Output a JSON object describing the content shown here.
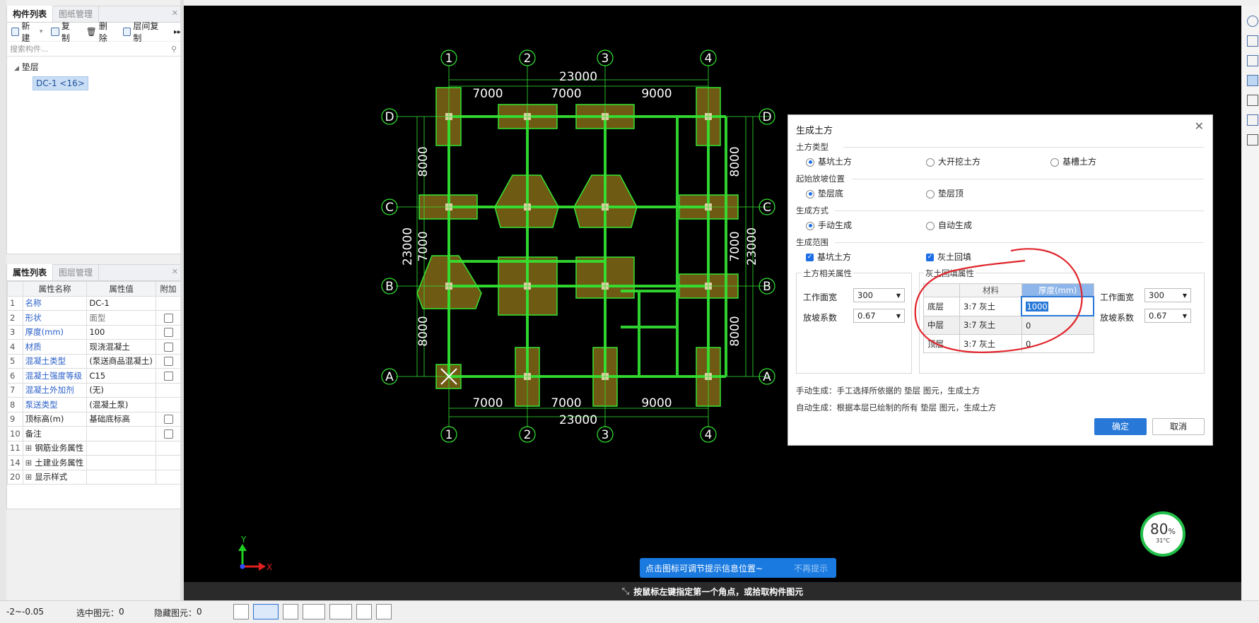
{
  "left_top_panel": {
    "tabs": [
      "构件列表",
      "图纸管理"
    ],
    "toolbar": {
      "new": "新建",
      "copy": "复制",
      "delete": "删除",
      "layer_copy": "层间复制"
    },
    "search_placeholder": "搜索构件...",
    "tree": {
      "group": "垫层",
      "item": "DC-1 <16>"
    }
  },
  "left_bottom_panel": {
    "tabs": [
      "属性列表",
      "图层管理"
    ],
    "headers": [
      "属性名称",
      "属性值",
      "附加"
    ],
    "rows": [
      {
        "no": "1",
        "name": "名称",
        "value": "DC-1",
        "blue": true,
        "check": false
      },
      {
        "no": "2",
        "name": "形状",
        "value": "面型",
        "blue": true,
        "check": true
      },
      {
        "no": "3",
        "name": "厚度(mm)",
        "value": "100",
        "blue": true,
        "check": true
      },
      {
        "no": "4",
        "name": "材质",
        "value": "现浇混凝土",
        "blue": true,
        "check": true
      },
      {
        "no": "5",
        "name": "混凝土类型",
        "value": "(泵送商品混凝土)",
        "blue": true,
        "check": true
      },
      {
        "no": "6",
        "name": "混凝土强度等级",
        "value": "C15",
        "blue": true,
        "check": true
      },
      {
        "no": "7",
        "name": "混凝土外加剂",
        "value": "(无)",
        "blue": true,
        "check": false
      },
      {
        "no": "8",
        "name": "泵送类型",
        "value": "(混凝土泵)",
        "blue": true,
        "check": false
      },
      {
        "no": "9",
        "name": "顶标高(m)",
        "value": "基础底标高",
        "blue": false,
        "check": true
      },
      {
        "no": "10",
        "name": "备注",
        "value": "",
        "blue": false,
        "check": true
      },
      {
        "no": "11",
        "name": "钢筋业务属性",
        "value": "",
        "blue": false,
        "check": false,
        "expand": true
      },
      {
        "no": "14",
        "name": "土建业务属性",
        "value": "",
        "blue": false,
        "check": false,
        "expand": true
      },
      {
        "no": "20",
        "name": "显示样式",
        "value": "",
        "blue": false,
        "check": false,
        "expand": true
      }
    ]
  },
  "drawing": {
    "axis_numbers": [
      "1",
      "2",
      "3",
      "4"
    ],
    "axis_letters": [
      "D",
      "C",
      "B",
      "A"
    ],
    "top_total": "23000",
    "bottom_total": "23000",
    "spans_top": [
      "7000",
      "7000",
      "9000"
    ],
    "spans_bottom": [
      "7000",
      "7000",
      "9000"
    ],
    "left_total": "23000",
    "right_total": "23000",
    "left_spans": [
      "8000",
      "7000",
      "8000"
    ],
    "right_spans": [
      "8000",
      "7000",
      "8000"
    ]
  },
  "dialog": {
    "title": "生成土方",
    "sections": {
      "type": "土方类型",
      "start": "起始放坡位置",
      "mode": "生成方式",
      "range": "生成范围"
    },
    "type_options": [
      "基坑土方",
      "大开挖土方",
      "基槽土方"
    ],
    "start_options": [
      "垫层底",
      "垫层顶"
    ],
    "mode_options": [
      "手动生成",
      "自动生成"
    ],
    "range_options": [
      "基坑土方",
      "灰土回填"
    ],
    "earth_group": {
      "title": "土方相关属性",
      "work_width_label": "工作面宽",
      "work_width": "300",
      "slope_label": "放坡系数",
      "slope": "0.67"
    },
    "fill_group": {
      "title": "灰土回填属性",
      "headers": [
        "材料",
        "厚度(mm)"
      ],
      "rows": [
        {
          "layer": "底层",
          "material": "3:7 灰土",
          "thickness": "1000"
        },
        {
          "layer": "中层",
          "material": "3:7 灰土",
          "thickness": "0"
        },
        {
          "layer": "顶层",
          "material": "3:7 灰土",
          "thickness": "0"
        }
      ],
      "work_width_label": "工作面宽",
      "work_width": "300",
      "slope_label": "放坡系数",
      "slope": "0.67"
    },
    "note_manual": "手动生成：手工选择所依据的 垫层 图元，生成土方",
    "note_auto": "自动生成：根据本层已绘制的所有 垫层 图元，生成土方",
    "ok": "确定",
    "cancel": "取消"
  },
  "tip": {
    "text": "点击图标可调节提示信息位置~",
    "dismiss": "不再提示"
  },
  "command_hint": "按鼠标左键指定第一个角点，或拾取构件图元",
  "gauge": {
    "value": "80",
    "unit": "%",
    "temp": "31°C"
  },
  "axes": {
    "x": "X",
    "y": "Y"
  },
  "statusbar": {
    "elevation": "-2~-0.05",
    "selected_label": "选中图元：",
    "selected": "0",
    "hidden_label": "隐藏图元：",
    "hidden": "0"
  },
  "colors": {
    "accent": "#2878d8",
    "grid": "#33e633",
    "pad": "#6e5a12",
    "annotation": "#e0242a"
  }
}
